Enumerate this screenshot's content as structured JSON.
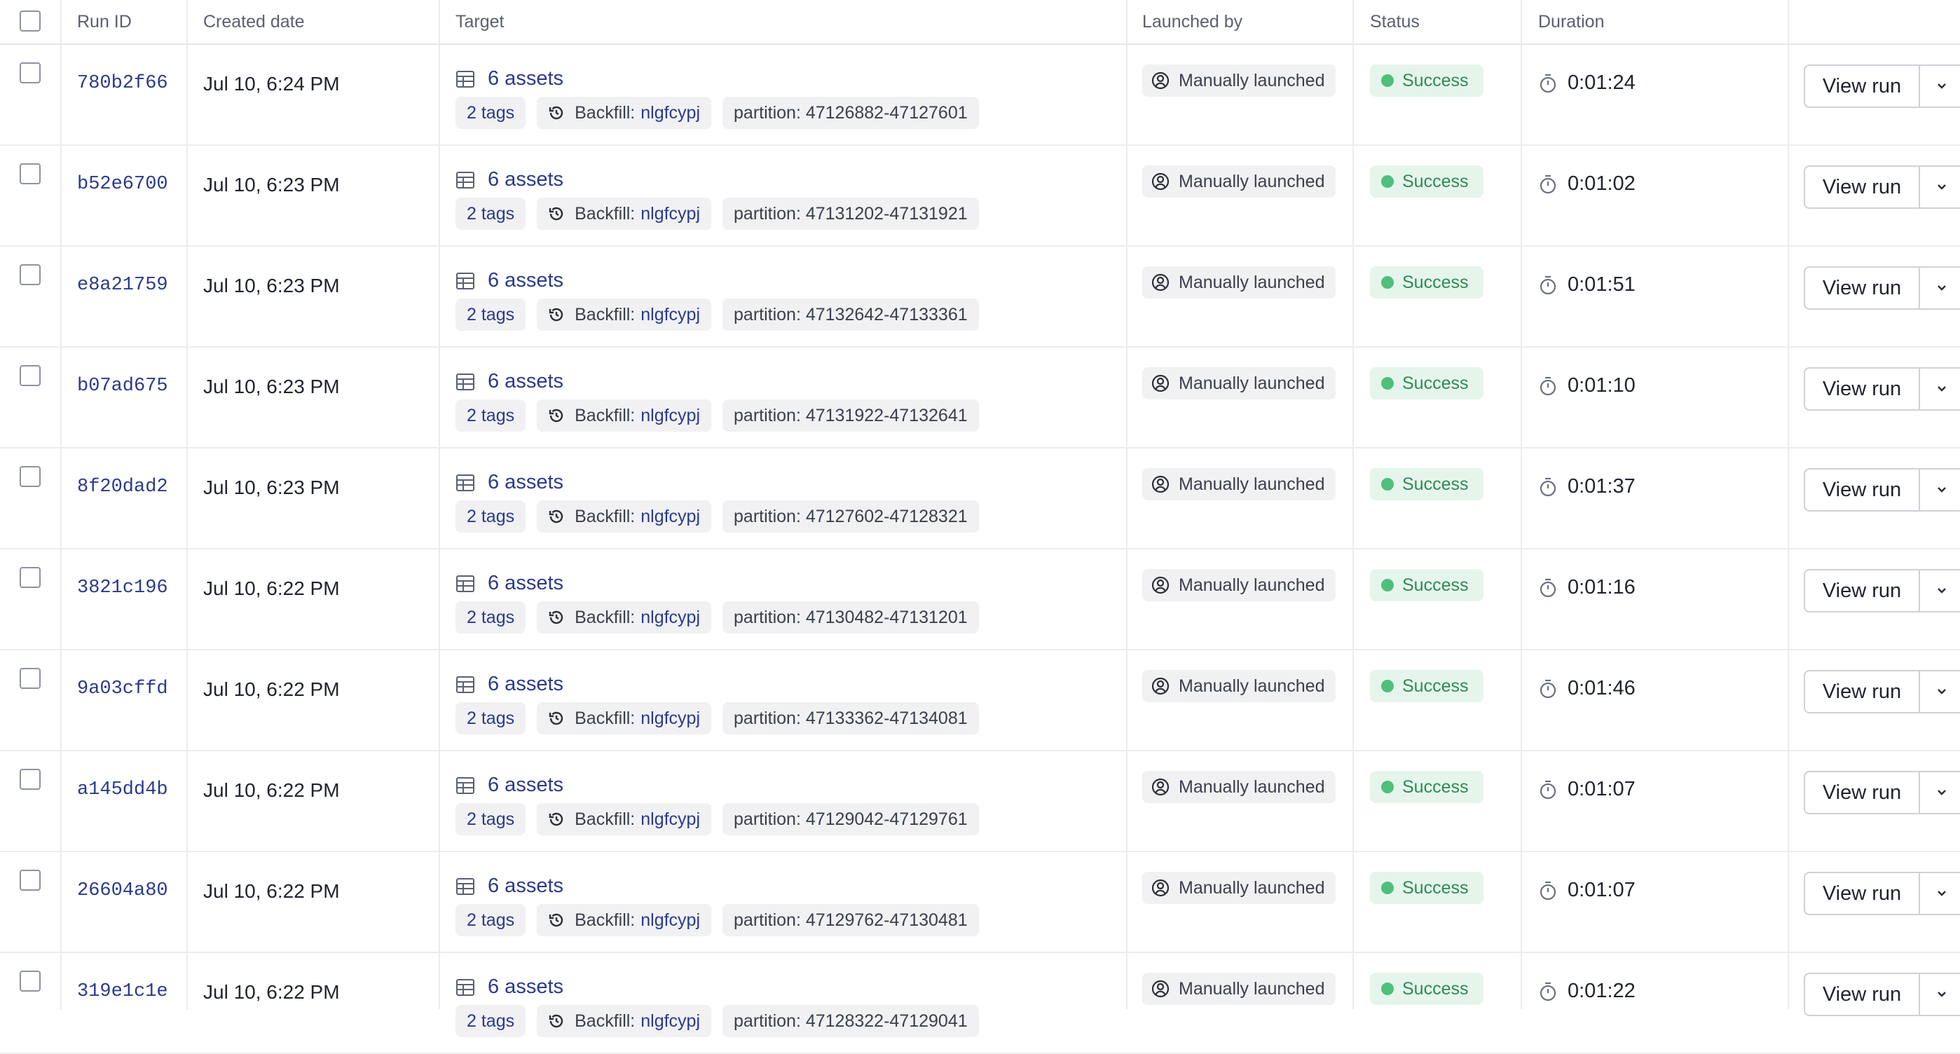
{
  "header": {
    "run_id": "Run ID",
    "created_date": "Created date",
    "target": "Target",
    "launched_by": "Launched by",
    "status": "Status",
    "duration": "Duration"
  },
  "rows": [
    {
      "run_id": "780b2f66",
      "created": "Jul 10, 6:24 PM",
      "assets": "6 assets",
      "tags": "2 tags",
      "backfill_label": "Backfill:",
      "backfill_id": "nlgfcypj",
      "partition": "partition: 47126882-47127601",
      "launched_by": "Manually launched",
      "status": "Success",
      "duration": "0:01:24",
      "view": "View run"
    },
    {
      "run_id": "b52e6700",
      "created": "Jul 10, 6:23 PM",
      "assets": "6 assets",
      "tags": "2 tags",
      "backfill_label": "Backfill:",
      "backfill_id": "nlgfcypj",
      "partition": "partition: 47131202-47131921",
      "launched_by": "Manually launched",
      "status": "Success",
      "duration": "0:01:02",
      "view": "View run"
    },
    {
      "run_id": "e8a21759",
      "created": "Jul 10, 6:23 PM",
      "assets": "6 assets",
      "tags": "2 tags",
      "backfill_label": "Backfill:",
      "backfill_id": "nlgfcypj",
      "partition": "partition: 47132642-47133361",
      "launched_by": "Manually launched",
      "status": "Success",
      "duration": "0:01:51",
      "view": "View run"
    },
    {
      "run_id": "b07ad675",
      "created": "Jul 10, 6:23 PM",
      "assets": "6 assets",
      "tags": "2 tags",
      "backfill_label": "Backfill:",
      "backfill_id": "nlgfcypj",
      "partition": "partition: 47131922-47132641",
      "launched_by": "Manually launched",
      "status": "Success",
      "duration": "0:01:10",
      "view": "View run"
    },
    {
      "run_id": "8f20dad2",
      "created": "Jul 10, 6:23 PM",
      "assets": "6 assets",
      "tags": "2 tags",
      "backfill_label": "Backfill:",
      "backfill_id": "nlgfcypj",
      "partition": "partition: 47127602-47128321",
      "launched_by": "Manually launched",
      "status": "Success",
      "duration": "0:01:37",
      "view": "View run"
    },
    {
      "run_id": "3821c196",
      "created": "Jul 10, 6:22 PM",
      "assets": "6 assets",
      "tags": "2 tags",
      "backfill_label": "Backfill:",
      "backfill_id": "nlgfcypj",
      "partition": "partition: 47130482-47131201",
      "launched_by": "Manually launched",
      "status": "Success",
      "duration": "0:01:16",
      "view": "View run"
    },
    {
      "run_id": "9a03cffd",
      "created": "Jul 10, 6:22 PM",
      "assets": "6 assets",
      "tags": "2 tags",
      "backfill_label": "Backfill:",
      "backfill_id": "nlgfcypj",
      "partition": "partition: 47133362-47134081",
      "launched_by": "Manually launched",
      "status": "Success",
      "duration": "0:01:46",
      "view": "View run"
    },
    {
      "run_id": "a145dd4b",
      "created": "Jul 10, 6:22 PM",
      "assets": "6 assets",
      "tags": "2 tags",
      "backfill_label": "Backfill:",
      "backfill_id": "nlgfcypj",
      "partition": "partition: 47129042-47129761",
      "launched_by": "Manually launched",
      "status": "Success",
      "duration": "0:01:07",
      "view": "View run"
    },
    {
      "run_id": "26604a80",
      "created": "Jul 10, 6:22 PM",
      "assets": "6 assets",
      "tags": "2 tags",
      "backfill_label": "Backfill:",
      "backfill_id": "nlgfcypj",
      "partition": "partition: 47129762-47130481",
      "launched_by": "Manually launched",
      "status": "Success",
      "duration": "0:01:07",
      "view": "View run"
    },
    {
      "run_id": "319e1c1e",
      "created": "Jul 10, 6:22 PM",
      "assets": "6 assets",
      "tags": "2 tags",
      "backfill_label": "Backfill:",
      "backfill_id": "nlgfcypj",
      "partition": "partition: 47128322-47129041",
      "launched_by": "Manually launched",
      "status": "Success",
      "duration": "0:01:22",
      "view": "View run"
    }
  ],
  "colors": {
    "link": "#2b3a8c",
    "success_bg": "#e6f5ec",
    "success_text": "#2f8a55",
    "success_dot": "#4fbf7c",
    "chip_bg": "#f1f1f3"
  },
  "icons": {
    "assets": "table-grid-icon",
    "backfill": "history-icon",
    "launched_by": "user-circle-icon",
    "duration": "timer-icon",
    "dropdown": "chevron-down-icon"
  }
}
